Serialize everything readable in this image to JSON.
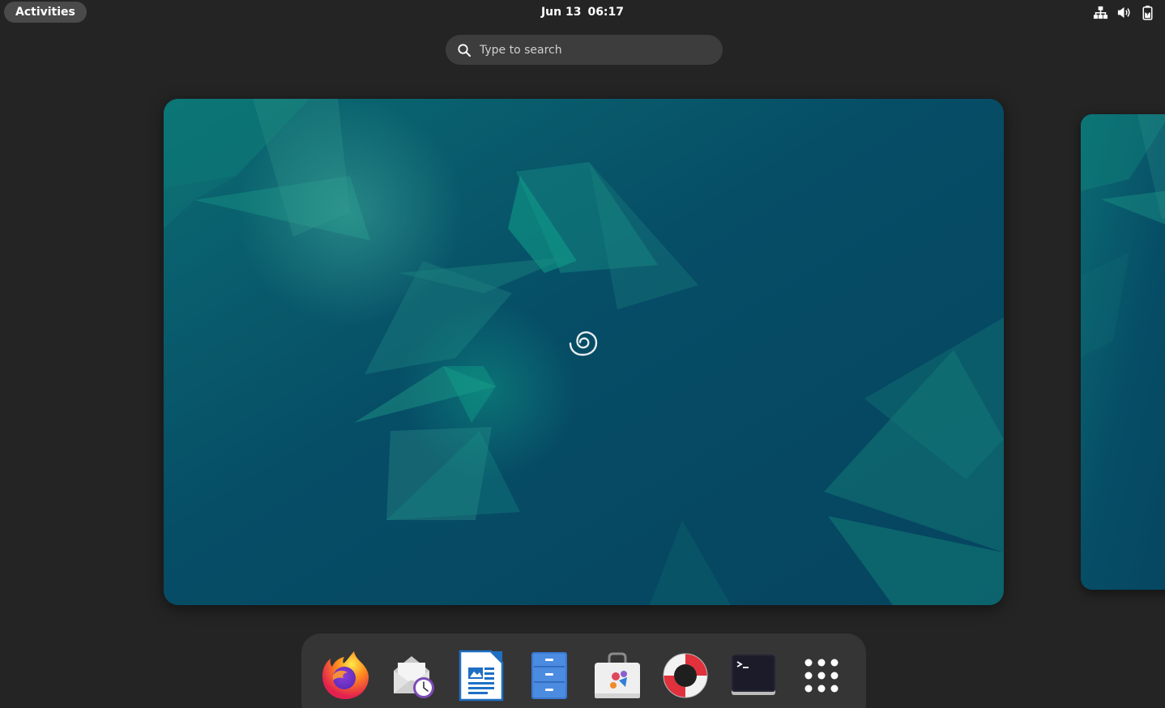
{
  "topbar": {
    "activities_label": "Activities",
    "date": "Jun 13",
    "time": "06:17",
    "tray_icons": [
      "network-wired-icon",
      "volume-icon",
      "battery-icon"
    ]
  },
  "search": {
    "placeholder": "Type to search"
  },
  "workspaces": [
    {
      "name": "workspace-1",
      "active": true
    },
    {
      "name": "workspace-2",
      "active": false
    }
  ],
  "dock": {
    "items": [
      {
        "icon": "firefox-icon"
      },
      {
        "icon": "evolution-mail-icon"
      },
      {
        "icon": "libreoffice-writer-icon"
      },
      {
        "icon": "files-icon"
      },
      {
        "icon": "software-icon"
      },
      {
        "icon": "help-icon"
      },
      {
        "icon": "terminal-icon"
      },
      {
        "icon": "show-apps-icon"
      }
    ]
  },
  "colors": {
    "background": "#242424",
    "wallpaper_base": "#05455e",
    "wallpaper_accent": "#0f8a7a",
    "dock": "#353535",
    "search": "#3d3d3d"
  }
}
